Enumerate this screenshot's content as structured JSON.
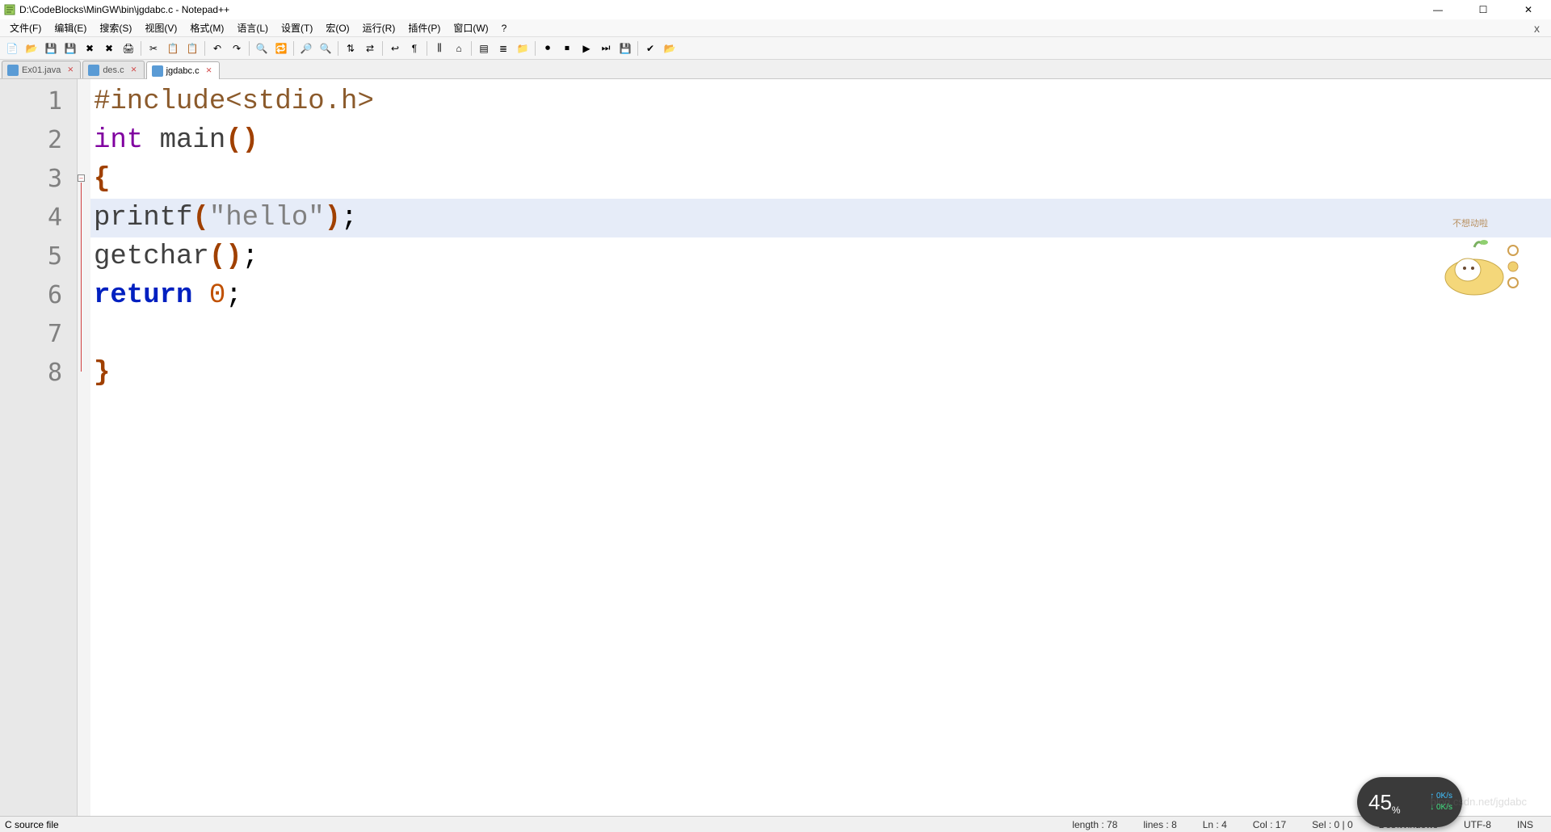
{
  "title": "D:\\CodeBlocks\\MinGW\\bin\\jgdabc.c - Notepad++",
  "menu": [
    "文件(F)",
    "编辑(E)",
    "搜索(S)",
    "视图(V)",
    "格式(M)",
    "语言(L)",
    "设置(T)",
    "宏(O)",
    "运行(R)",
    "插件(P)",
    "窗口(W)",
    "?"
  ],
  "tabs": [
    {
      "label": "Ex01.java",
      "active": false,
      "dirty": true
    },
    {
      "label": "des.c",
      "active": false,
      "dirty": true
    },
    {
      "label": "jgdabc.c",
      "active": true,
      "dirty": true
    }
  ],
  "code_lines": [
    {
      "n": 1,
      "html": "<span class='preproc'>#include&lt;stdio.h&gt;</span>"
    },
    {
      "n": 2,
      "html": "<span class='kw-type'>int</span> <span class='func'>main</span><span class='paren'>()</span>"
    },
    {
      "n": 3,
      "html": "<span class='paren'>{</span>"
    },
    {
      "n": 4,
      "html": "<span class='func'>printf</span><span class='paren'>(</span><span class='str'>\"hello\"</span><span class='paren'>)</span>;",
      "current": true
    },
    {
      "n": 5,
      "html": "<span class='func'>getchar</span><span class='paren'>()</span>;"
    },
    {
      "n": 6,
      "html": "<span class='kw'>return</span> <span class='num'>0</span>;"
    },
    {
      "n": 7,
      "html": ""
    },
    {
      "n": 8,
      "html": "<span class='paren'>}</span>"
    }
  ],
  "sticker_text": "不想动啦",
  "status": {
    "filetype": "C source file",
    "length": "length : 78",
    "lines": "lines : 8",
    "ln": "Ln : 4",
    "col": "Col : 17",
    "sel": "Sel : 0 | 0",
    "eol": "Dos\\Windows",
    "enc": "UTF-8",
    "ins": "INS"
  },
  "widget": {
    "percent": "45",
    "pct_suffix": "%",
    "up": "0K/s",
    "dn": "0K/s"
  },
  "watermark": "blog.csdn.net/jgdabc",
  "toolbar_icons": [
    "new-file-icon",
    "open-file-icon",
    "save-icon",
    "save-all-icon",
    "close-icon",
    "close-all-icon",
    "print-icon",
    "|",
    "cut-icon",
    "copy-icon",
    "paste-icon",
    "|",
    "undo-icon",
    "redo-icon",
    "|",
    "find-icon",
    "replace-icon",
    "|",
    "zoom-in-icon",
    "zoom-out-icon",
    "|",
    "sync-v-icon",
    "sync-h-icon",
    "|",
    "wrap-icon",
    "show-all-icon",
    "|",
    "indent-guide-icon",
    "lang-icon",
    "|",
    "doc-map-icon",
    "func-list-icon",
    "folder-icon",
    "|",
    "record-macro-icon",
    "stop-macro-icon",
    "play-macro-icon",
    "play-multi-icon",
    "save-macro-icon",
    "|",
    "spellcheck-icon",
    "open-folder-icon"
  ]
}
